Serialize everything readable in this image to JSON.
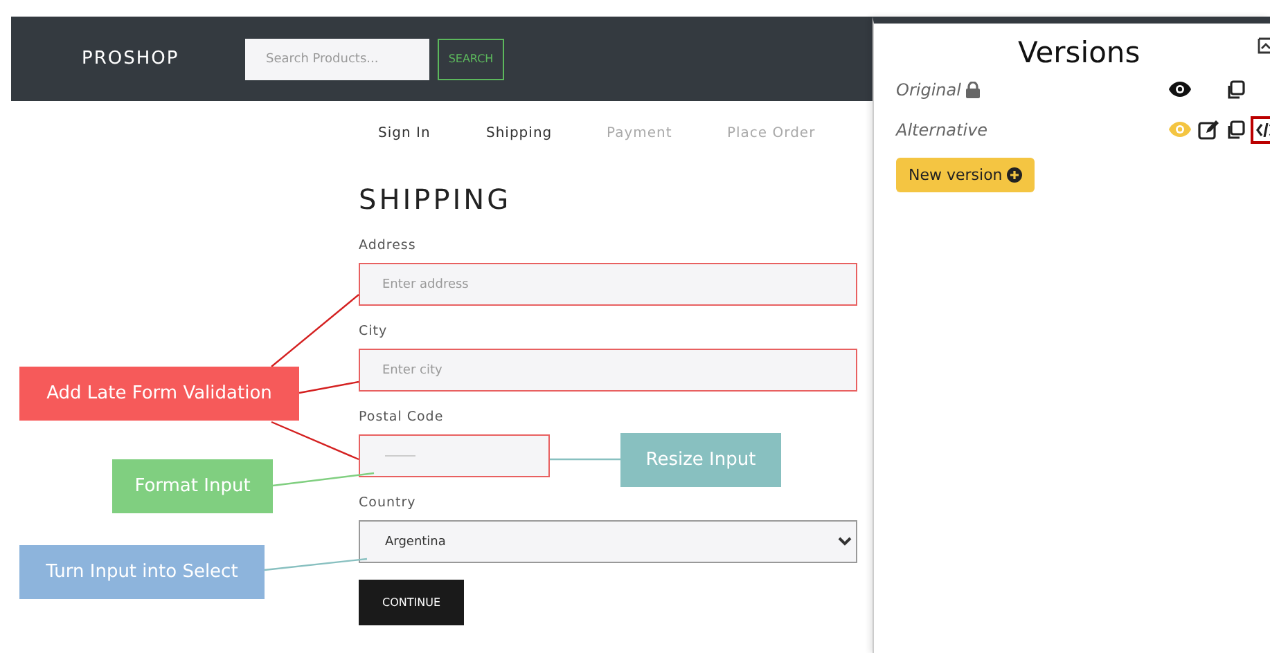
{
  "navbar": {
    "brand": "PROSHOP",
    "search": {
      "placeholder": "Search Products..."
    },
    "search_button": "SEARCH"
  },
  "steps": [
    {
      "label": "Sign In",
      "disabled": false
    },
    {
      "label": "Shipping",
      "disabled": false
    },
    {
      "label": "Payment",
      "disabled": true
    },
    {
      "label": "Place Order",
      "disabled": true
    }
  ],
  "form": {
    "title": "SHIPPING",
    "fields": [
      {
        "kind": "input",
        "label": "Address",
        "placeholder": "Enter address",
        "invalid": true
      },
      {
        "kind": "input",
        "label": "City",
        "placeholder": "Enter city",
        "invalid": true
      },
      {
        "kind": "short",
        "label": "Postal Code",
        "invalid": true
      },
      {
        "kind": "select",
        "label": "Country",
        "value": "Argentina",
        "invalid": false
      }
    ],
    "submit": "CONTINUE"
  },
  "annotations": [
    {
      "text": "Add Late Form Validation",
      "color": "#f65a5a"
    },
    {
      "text": "Format Input",
      "color": "#80cf80"
    },
    {
      "text": "Resize Input",
      "color": "#88c0c0"
    },
    {
      "text": "Turn Input into Select",
      "color": "#8db4dc"
    }
  ],
  "versions_panel": {
    "title": "Versions",
    "versions": [
      {
        "name": "Original",
        "locked": true,
        "selected": false,
        "editable": false
      },
      {
        "name": "Alternative",
        "locked": false,
        "selected": true,
        "editable": true
      }
    ],
    "new_button": "New version"
  }
}
